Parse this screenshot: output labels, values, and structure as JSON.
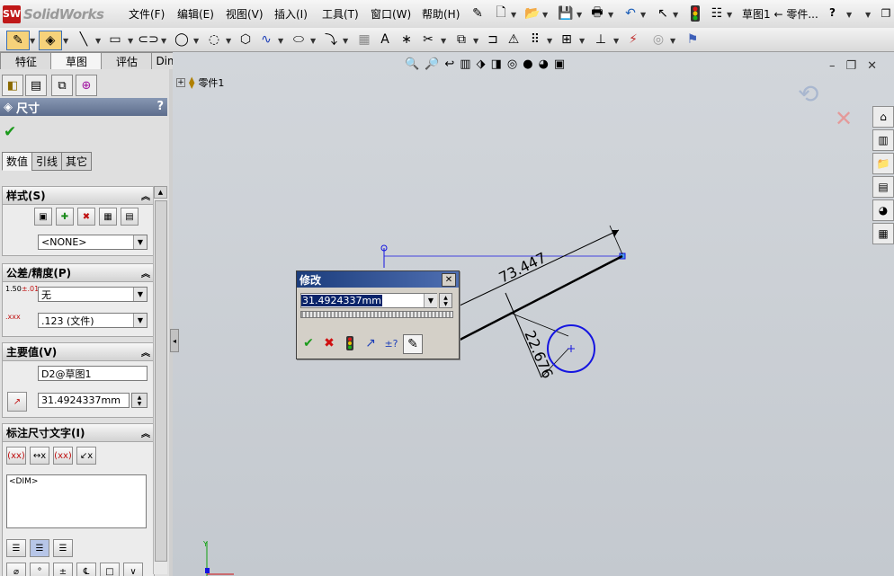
{
  "app": {
    "logo_text": "SolidWorks",
    "logo_badge": "SW"
  },
  "menu": {
    "items": [
      "文件(F)",
      "编辑(E)",
      "视图(V)",
      "插入(I)",
      "工具(T)",
      "窗口(W)",
      "帮助(H)"
    ],
    "document_title": "草图1 ← 零件...",
    "help_symbol": "?"
  },
  "command_manager": {
    "tabs": [
      "特征",
      "草图",
      "评估",
      "DimXpert"
    ],
    "active_tab": "草图"
  },
  "property_manager": {
    "title": "尺寸",
    "help": "?",
    "tabs": [
      "数值",
      "引线",
      "其它"
    ],
    "style_group": {
      "title": "样式(S)",
      "style_select": "<NONE>"
    },
    "tolerance_group": {
      "title": "公差/精度(P)",
      "tolerance_select": "无",
      "precision_select": ".123 (文件)"
    },
    "primary_value_group": {
      "title": "主要值(V)",
      "name_field": "D2@草图1",
      "value_field": "31.4924337mm"
    },
    "dimension_text_group": {
      "title": "标注尺寸文字(I)",
      "text_area": "<DIM>"
    }
  },
  "graphics": {
    "tree_root": "零件1",
    "dim_long": "73.447",
    "dim_short": "22.676"
  },
  "modify_dialog": {
    "title": "修改",
    "close": "✕",
    "value": "31.4924337mm"
  },
  "colors": {
    "accent_blue": "#1c3d7c",
    "sketch_blue": "#1515e0",
    "ok_green": "#1b9a1b",
    "cancel_red": "#d01010"
  }
}
